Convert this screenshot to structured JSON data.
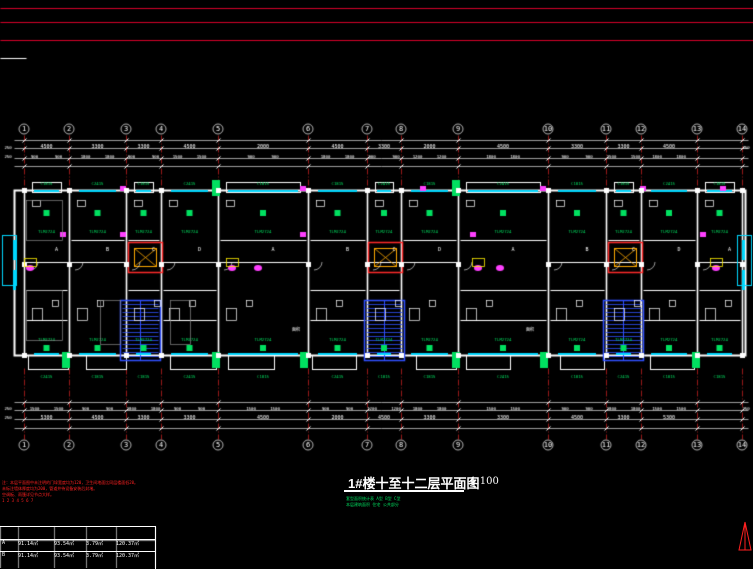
{
  "drawing": {
    "title": "1#楼十至十二层平面图",
    "scale": "1:100",
    "colors": {
      "background": "#000000",
      "frame": "#d8002a",
      "wall": "#ffffff",
      "axis": "#ff2a2a",
      "dimension": "#c8c8c8",
      "room_text": "#00e060",
      "window": "#00d8ff",
      "door": "#ff40ff",
      "stair": "#3050ff",
      "note": "#ff2020",
      "title": "#ffffff"
    }
  },
  "axes": [
    "1",
    "2",
    "3",
    "4",
    "5",
    "6",
    "7",
    "8",
    "9",
    "10",
    "11",
    "12",
    "13",
    "14"
  ],
  "dims": {
    "top_total": [
      "4500",
      "3300",
      "3300",
      "4500",
      "2000",
      "4500",
      "3300",
      "2000",
      "4500",
      "3300",
      "3300",
      "4500"
    ],
    "top_parts": [
      "900",
      "1800",
      "900",
      "1500",
      "900",
      "1800",
      "900",
      "1200",
      "1800",
      "900",
      "1500",
      "1800"
    ],
    "bottom_total": [
      "5300",
      "4500",
      "3300",
      "3300",
      "4500",
      "2000",
      "4500",
      "3300",
      "3300",
      "4500",
      "3300",
      "5300"
    ],
    "bottom_parts": [
      "1500",
      "900",
      "1800",
      "900",
      "1500",
      "900",
      "1200",
      "1800",
      "1500",
      "900",
      "1800",
      "1500"
    ],
    "level_label": "250"
  },
  "rooms": {
    "living": "客厅",
    "bedroom": "卧室",
    "kitchen": "厨房",
    "toilet": "卫生间",
    "stair": "楼梯间",
    "area": "面积",
    "window_labels": [
      "C1815",
      "C2415",
      "C1815",
      "C2415",
      "C1815",
      "C1815",
      "C2415",
      "C1815",
      "C2415",
      "C1815"
    ],
    "door_labels": [
      "TLM2724",
      "TLM2724",
      "TLM2724",
      "TLM2724",
      "TLM2724",
      "TLM2724"
    ]
  },
  "notes": [
    "注：本层平面图中未注明的门垛宽度均为120，卫生间地面比同层楼面低20。",
    "未标注墙体厚度均为200，管道井待设备安装后封堵。",
    "空调板、雨篷详见节点大样。",
    "1 2 3 4 5 6 7"
  ],
  "subtitle_lines": [
    "套型面积统计表  A型  B型  C型",
    "本层建筑面积  住宅  公共部分"
  ],
  "area_table": {
    "rows": [
      [
        "A",
        "91.14㎡",
        "93.54㎡",
        "3.79㎡",
        "120.37㎡"
      ],
      [
        "B",
        "91.14㎡",
        "93.54㎡",
        "3.79㎡",
        "120.37㎡"
      ]
    ]
  }
}
